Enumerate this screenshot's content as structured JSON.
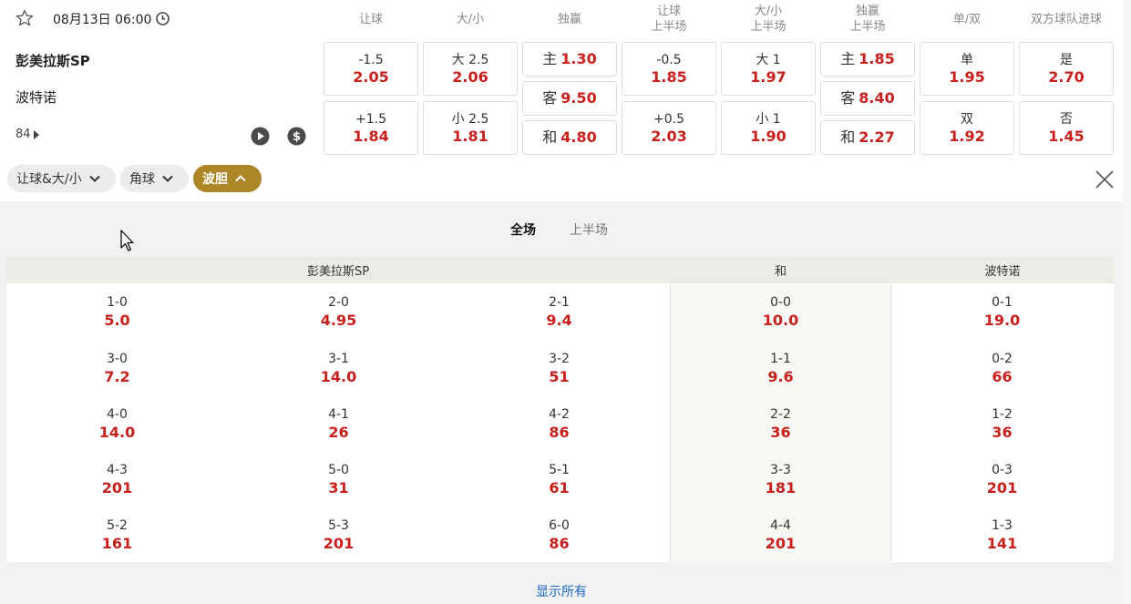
{
  "match": {
    "datetime": "08月13日 06:00",
    "home": "彭美拉斯SP",
    "away": "波特诺",
    "more_markets": "84"
  },
  "market_headers": [
    {
      "l1": "让球",
      "l2": ""
    },
    {
      "l1": "大/小",
      "l2": ""
    },
    {
      "l1": "独赢",
      "l2": ""
    },
    {
      "l1": "让球",
      "l2": "上半场"
    },
    {
      "l1": "大/小",
      "l2": "上半场"
    },
    {
      "l1": "独赢",
      "l2": "上半场"
    },
    {
      "l1": "单/双",
      "l2": ""
    },
    {
      "l1": "双方球队进球",
      "l2": ""
    }
  ],
  "markets": {
    "handicap": [
      {
        "label": "-1.5",
        "odds": "2.05"
      },
      {
        "label": "+1.5",
        "odds": "1.84"
      }
    ],
    "total": [
      {
        "label": "大 2.5",
        "odds": "2.06"
      },
      {
        "label": "小 2.5",
        "odds": "1.81"
      }
    ],
    "moneyline": [
      {
        "label": "主",
        "odds": "1.30"
      },
      {
        "label": "客",
        "odds": "9.50"
      },
      {
        "label": "和",
        "odds": "4.80"
      }
    ],
    "handicap_1h": [
      {
        "label": "-0.5",
        "odds": "1.85"
      },
      {
        "label": "+0.5",
        "odds": "2.03"
      }
    ],
    "total_1h": [
      {
        "label": "大 1",
        "odds": "1.97"
      },
      {
        "label": "小 1",
        "odds": "1.90"
      }
    ],
    "moneyline_1h": [
      {
        "label": "主",
        "odds": "1.85"
      },
      {
        "label": "客",
        "odds": "8.40"
      },
      {
        "label": "和",
        "odds": "2.27"
      }
    ],
    "odd_even": [
      {
        "label": "单",
        "odds": "1.95"
      },
      {
        "label": "双",
        "odds": "1.92"
      }
    ],
    "btts": [
      {
        "label": "是",
        "odds": "2.70"
      },
      {
        "label": "否",
        "odds": "1.45"
      }
    ]
  },
  "filters": {
    "handicap_total": "让球&大/小",
    "corners": "角球",
    "correct_score": "波胆"
  },
  "tabs": {
    "full": "全场",
    "half": "上半场"
  },
  "correct_score": {
    "headers": {
      "home": "彭美拉斯SP",
      "draw": "和",
      "away": "波特诺"
    },
    "col1": [
      {
        "s": "1-0",
        "o": "5.0"
      },
      {
        "s": "3-0",
        "o": "7.2"
      },
      {
        "s": "4-0",
        "o": "14.0"
      },
      {
        "s": "4-3",
        "o": "201"
      },
      {
        "s": "5-2",
        "o": "161"
      }
    ],
    "col2": [
      {
        "s": "2-0",
        "o": "4.95"
      },
      {
        "s": "3-1",
        "o": "14.0"
      },
      {
        "s": "4-1",
        "o": "26"
      },
      {
        "s": "5-0",
        "o": "31"
      },
      {
        "s": "5-3",
        "o": "201"
      }
    ],
    "col3": [
      {
        "s": "2-1",
        "o": "9.4"
      },
      {
        "s": "3-2",
        "o": "51"
      },
      {
        "s": "4-2",
        "o": "86"
      },
      {
        "s": "5-1",
        "o": "61"
      },
      {
        "s": "6-0",
        "o": "86"
      }
    ],
    "col4": [
      {
        "s": "0-0",
        "o": "10.0"
      },
      {
        "s": "1-1",
        "o": "9.6"
      },
      {
        "s": "2-2",
        "o": "36"
      },
      {
        "s": "3-3",
        "o": "181"
      },
      {
        "s": "4-4",
        "o": "201"
      }
    ],
    "col5": [
      {
        "s": "0-1",
        "o": "19.0"
      },
      {
        "s": "0-2",
        "o": "66"
      },
      {
        "s": "1-2",
        "o": "36"
      },
      {
        "s": "0-3",
        "o": "201"
      },
      {
        "s": "1-3",
        "o": "141"
      }
    ]
  },
  "show_all": "显示所有",
  "colors": {
    "odds": "#c8201c",
    "active_chip": "#ad8627",
    "link": "#1a66c2"
  }
}
